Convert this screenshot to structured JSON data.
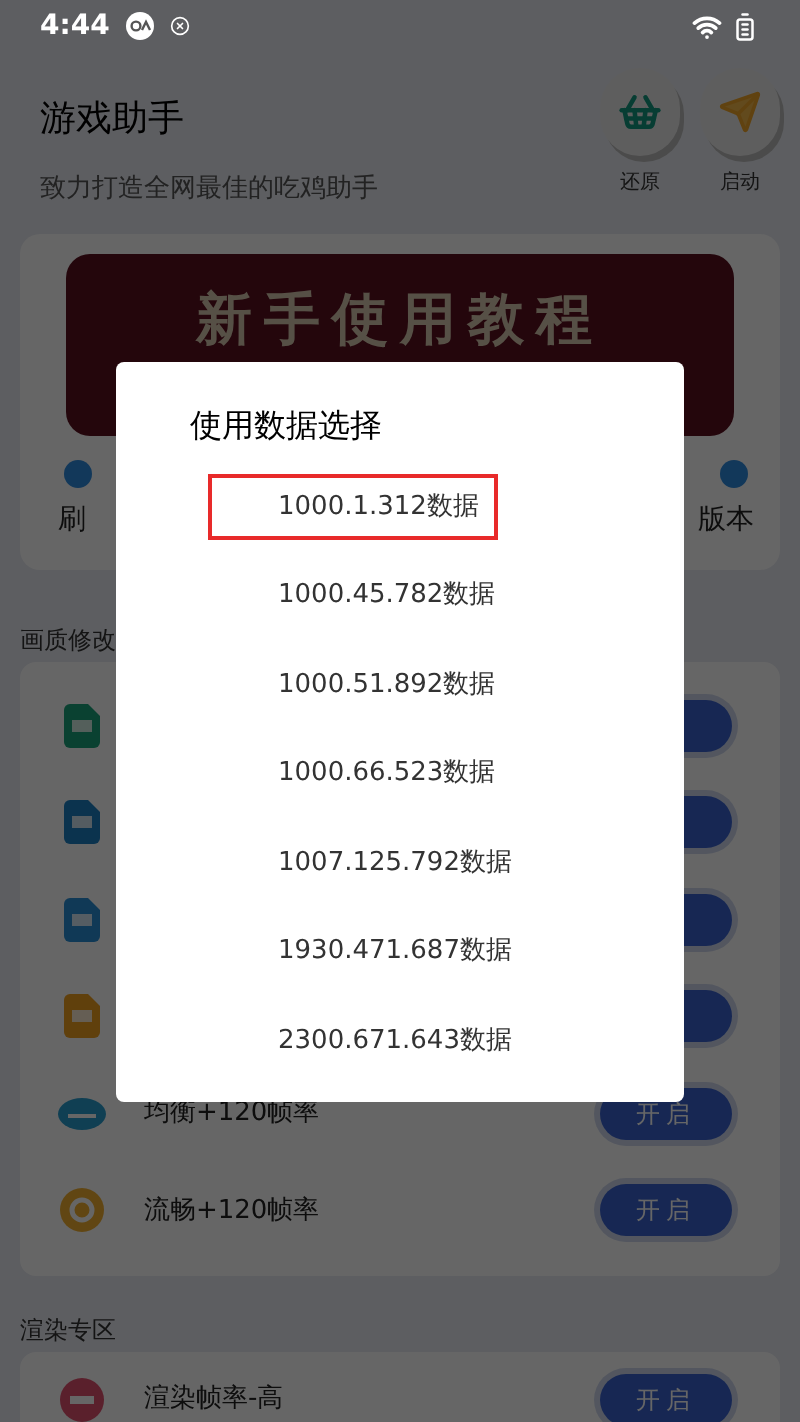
{
  "status_bar": {
    "time": "4:44"
  },
  "header": {
    "title": "游戏助手",
    "subtitle": "致力打造全网最佳的吃鸡助手",
    "actions": [
      {
        "label": "还原",
        "kind": "basket"
      },
      {
        "label": "启动",
        "kind": "plane"
      }
    ]
  },
  "banner": {
    "title": "新手使用教程",
    "shortcuts": [
      {
        "label": "刷"
      },
      {
        "label": "版本"
      }
    ]
  },
  "sections": [
    {
      "title": "画质修改",
      "rows": [
        {
          "kind": "covered"
        },
        {
          "kind": "covered"
        },
        {
          "kind": "covered"
        },
        {
          "kind": "covered"
        },
        {
          "kind": "full",
          "name": "均衡+120帧率",
          "button": "开启"
        },
        {
          "kind": "full",
          "name": "流畅+120帧率",
          "button": "开启"
        }
      ]
    },
    {
      "title": "渲染专区",
      "rows": [
        {
          "kind": "full",
          "name": "渲染帧率-高",
          "button": "开启"
        }
      ]
    }
  ],
  "dialog": {
    "title": "使用数据选择",
    "options": [
      {
        "label": "1000.1.312数据",
        "selected": true
      },
      {
        "label": "1000.45.782数据",
        "selected": false
      },
      {
        "label": "1000.51.892数据",
        "selected": false
      },
      {
        "label": "1000.66.523数据",
        "selected": false
      },
      {
        "label": "1007.125.792数据",
        "selected": false
      },
      {
        "label": "1930.471.687数据",
        "selected": false
      },
      {
        "label": "2300.671.643数据",
        "selected": false
      }
    ]
  }
}
